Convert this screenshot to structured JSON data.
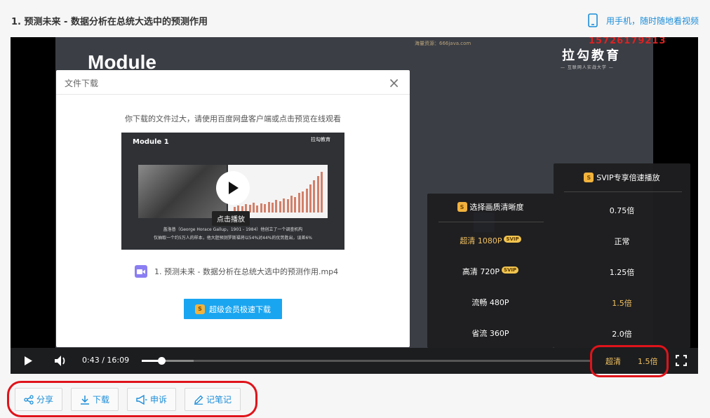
{
  "header": {
    "title": "1. 预测未来 - 数据分析在总统大选中的预测作用",
    "mobile_link": "用手机，随时随地看视频"
  },
  "video": {
    "slide_title": "Module",
    "watermark": "海量资源：666java.com",
    "phone_watermark": "15726179213",
    "brand": "拉勾教育",
    "brand_sub": "— 互联网人实战大学 —"
  },
  "modal": {
    "title": "文件下载",
    "close": "×",
    "message": "你下载的文件过大，请使用百度网盘客户端或点击预览在线观看",
    "thumb_title": "Module 1",
    "thumb_brand": "拉勾教育",
    "thumb_caption1": "盖洛普（George Horace Gallup，1901 - 1984）他创立了一个调查机构",
    "thumb_caption2": "仅抽取一个约5万人的样本，他大胆预测罗斯福将以54%对44%的优势胜出，误差6%",
    "play_tip": "点击播放",
    "file_name": "1. 预测未来 - 数据分析在总统大选中的预测作用.mp4",
    "svip_download": "超级会员极速下载"
  },
  "quality_menu": {
    "title": "选择画质清晰度",
    "options": [
      {
        "label": "超清 1080P",
        "badge": "SVIP"
      },
      {
        "label": "高清 720P",
        "badge": "SVIP"
      },
      {
        "label": "流畅 480P",
        "badge": ""
      },
      {
        "label": "省流 360P",
        "badge": ""
      }
    ],
    "selected_index": 0
  },
  "speed_menu": {
    "title": "SVIP专享倍速播放",
    "options": [
      "0.75倍",
      "正常",
      "1.25倍",
      "1.5倍",
      "2.0倍"
    ],
    "selected_index": 3
  },
  "controls": {
    "current_time": "0:43",
    "separator": "/",
    "duration": "16:09",
    "played_fraction": 0.044,
    "buffered_fraction": 0.115,
    "quality": "超清",
    "speed": "1.5倍"
  },
  "actions": {
    "share": "分享",
    "download": "下载",
    "report": "申诉",
    "notes": "记笔记"
  },
  "colors": {
    "accent_blue": "#1c8ed9",
    "gold": "#f2c262",
    "highlight_red": "#e0131a"
  }
}
